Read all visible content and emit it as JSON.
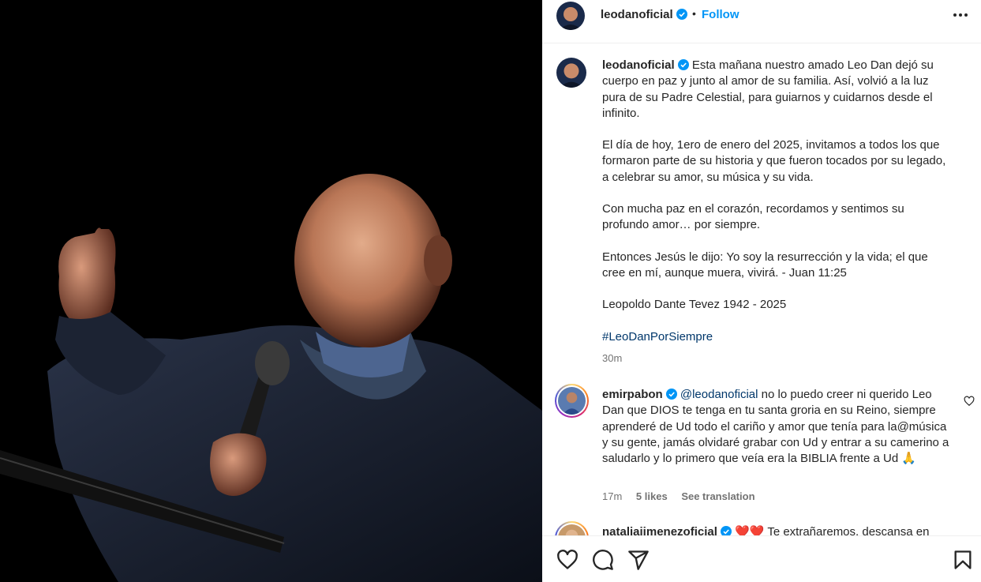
{
  "post": {
    "author": "leodanoficial",
    "follow_label": "Follow",
    "separator": "•",
    "caption": {
      "p1": "Esta mañana nuestro amado Leo Dan dejó su cuerpo en paz y junto al amor de su familia. Así, volvió a la luz pura de su Padre Celestial, para guiarnos y cuidarnos desde el infinito.",
      "p2": "El día de hoy, 1ero de enero del 2025, invitamos a todos los que formaron parte de su historia y que fueron tocados por su legado, a celebrar su amor, su música y su vida.",
      "p3": "Con mucha paz en el corazón, recordamos y sentimos su profundo amor… por siempre.",
      "p4": "Entonces Jesús le dijo: Yo soy la resurrección y la vida; el que cree en mí, aunque muera, vivirá. - Juan 11:25",
      "p5": "Leopoldo Dante Tevez 1942 - 2025",
      "hashtag": "#LeoDanPorSiempre"
    },
    "time": "30m"
  },
  "comments": [
    {
      "user": "emirpabon",
      "mention": "@leodanoficial",
      "text": " no lo puedo creer ni querido Leo Dan que DIOS te tenga en tu santa groria en su Reino, siempre aprenderé de Ud todo el cariño y amor que tenía para la@música y su gente, jamás olvidaré grabar con Ud y entrar a su camerino a saludarlo y lo primero que veía era la BIBLIA frente a Ud 🙏",
      "time": "17m",
      "likes": "5 likes",
      "translate": "See translation"
    },
    {
      "user": "nataliajimenezoficial",
      "text": "❤️❤️ Te extrañaremos, descansa en"
    }
  ],
  "icons": {
    "verified": "verified-badge-icon",
    "more": "more-options-icon",
    "like": "heart-icon",
    "comment": "comment-icon",
    "share": "share-icon",
    "save": "bookmark-icon"
  },
  "colors": {
    "follow": "#0095f6",
    "verified": "#0095f6",
    "link": "#00376b",
    "muted": "#737373"
  }
}
